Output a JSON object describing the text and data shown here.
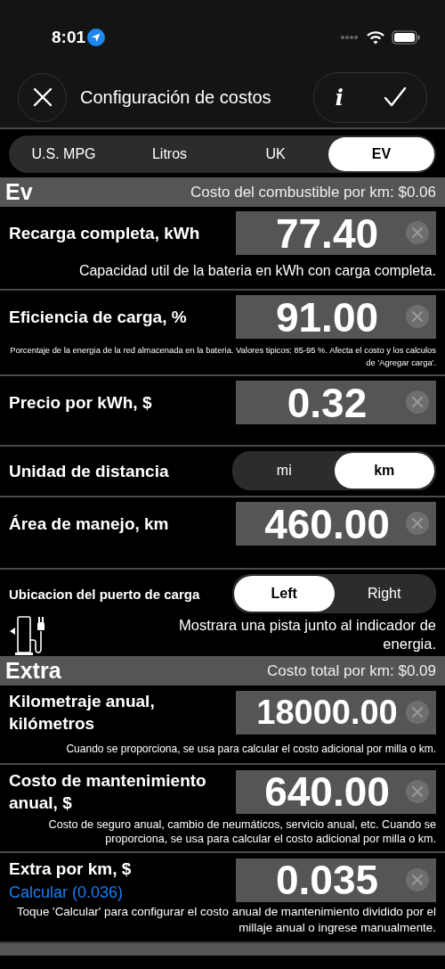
{
  "status_bar": {
    "time": "8:01"
  },
  "nav": {
    "title": "Configuración de costos",
    "info_label": "i"
  },
  "unit_tabs": [
    {
      "label": "U.S. MPG",
      "selected": false
    },
    {
      "label": "Litros",
      "selected": false
    },
    {
      "label": "UK",
      "selected": false
    },
    {
      "label": "EV",
      "selected": true
    }
  ],
  "sections": [
    {
      "title": "Ev",
      "summary": "Costo del combustible por km: $0.06",
      "rows": [
        {
          "kind": "field",
          "label": "Recarga completa, kWh",
          "value": "77.40",
          "note": "Capacidad util de la bateria en kWh con carga completa."
        },
        {
          "kind": "field",
          "label": "Eficiencia de carga, %",
          "value": "91.00",
          "note": "Porcentaje de la energia de la red almacenada en la bateria. Valores tipicos: 85-95 %. Afecta el costo y los calculos de 'Agregar carga'."
        },
        {
          "kind": "field",
          "label": "Precio por kWh, $",
          "value": "0.32"
        },
        {
          "kind": "segment",
          "label": "Unidad de distancia",
          "options": [
            {
              "label": "mi",
              "selected": false
            },
            {
              "label": "km",
              "selected": true
            }
          ]
        },
        {
          "kind": "field",
          "label": "Área de manejo, km",
          "value": "460.00"
        },
        {
          "kind": "port",
          "label": "Ubicacion del puerto de carga",
          "options": [
            {
              "label": "Left",
              "selected": true
            },
            {
              "label": "Right",
              "selected": false
            }
          ],
          "hint": "Mostrara una pista junto al indicador de energia."
        }
      ]
    },
    {
      "title": "Extra",
      "summary": "Costo total por km: $0.09",
      "rows": [
        {
          "kind": "field",
          "label": "Kilometraje anual, kilómetros",
          "value": "18000.00",
          "note": "Cuando se proporciona, se usa para calcular el costo adicional por milla o km."
        },
        {
          "kind": "field",
          "label": "Costo de mantenimiento anual, $",
          "value": "640.00",
          "note": "Costo de seguro anual, cambio de neumáticos, servicio anual, etc. Cuando se proporciona, se usa para calcular el costo adicional por milla o km."
        },
        {
          "kind": "field",
          "label": "Extra por km, $",
          "link": "Calcular (0.036)",
          "value": "0.035",
          "note": "Toque 'Calcular' para configurar el costo anual de mantenimiento dividido por el millaje anual o ingrese manualmente."
        }
      ]
    }
  ]
}
